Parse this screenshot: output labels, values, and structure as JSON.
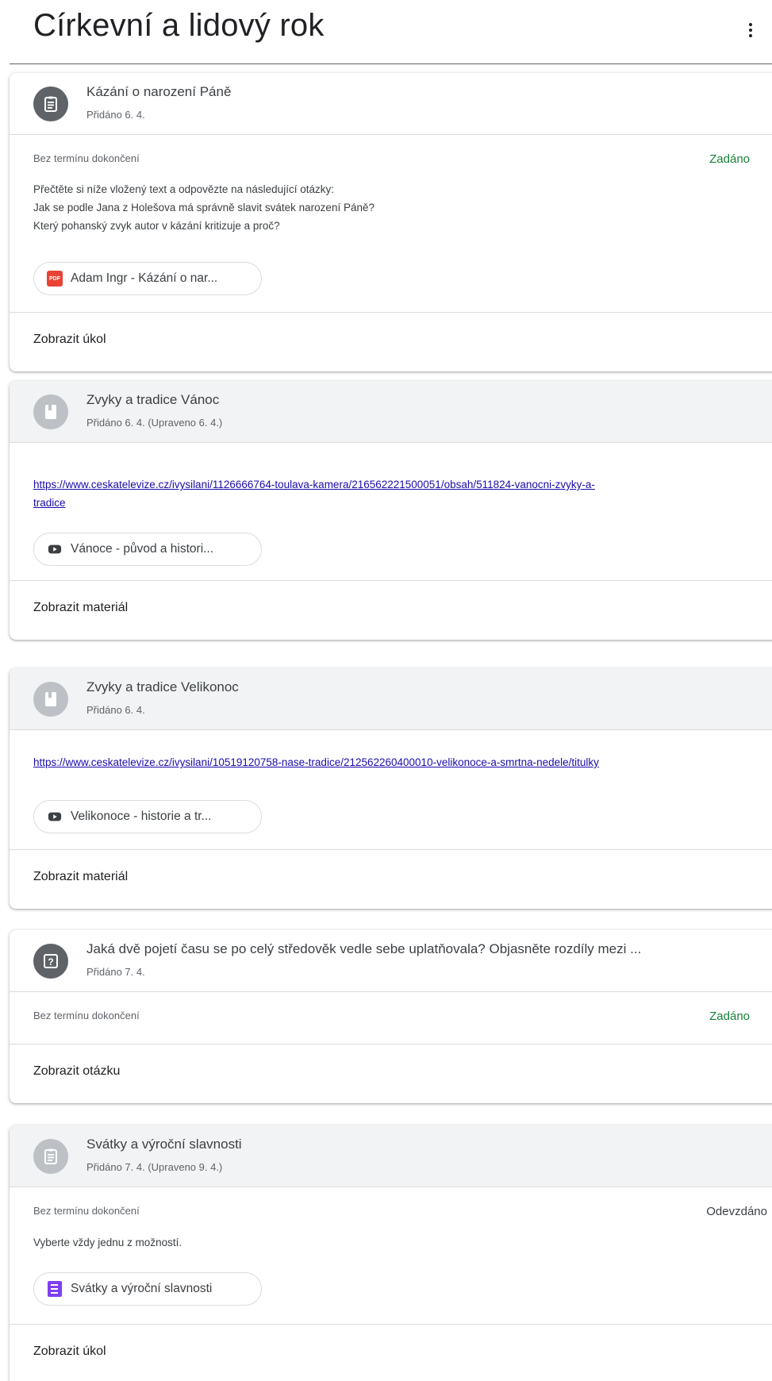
{
  "page": {
    "title": "Církevní a lidový rok"
  },
  "icons": {
    "menu": "more-vert-icon",
    "assignment": "assignment-icon",
    "material": "book-icon",
    "question": "question-icon",
    "pdf": "pdf-icon",
    "youtube": "youtube-icon",
    "forms": "forms-icon"
  },
  "colors": {
    "status_assigned": "#188038",
    "link": "#1a0dab",
    "pdf": "#ea4335",
    "forms": "#7e3ff2"
  },
  "cards": [
    {
      "type": "assignment",
      "title": "Kázání o narození Páně",
      "posted": "Přidáno 6. 4.",
      "due": "Bez termínu dokončení",
      "status": "Zadáno",
      "description": [
        "Přečtěte si níže vložený text a odpovězte na následující otázky:",
        "Jak se podle Jana z Holešova má správně slavit svátek narození Páně?",
        "Který pohanský zvyk autor v kázání kritizuje a proč?"
      ],
      "attachment": "Adam Ingr - Kázání o nar...",
      "footer": "Zobrazit úkol"
    },
    {
      "type": "material",
      "title": "Zvyky a tradice Vánoc",
      "posted": "Přidáno 6. 4. (Upraveno 6. 4.)",
      "link_line1": "https://www.ceskatelevize.cz/ivysilani/1126666764-toulava-kamera/216562221500051/obsah/511824-vanocni-zvyky-a-",
      "link_line2": "tradice",
      "attachment": "Vánoce - původ a histori...",
      "footer": "Zobrazit materiál"
    },
    {
      "type": "material",
      "title": "Zvyky a tradice Velikonoc",
      "posted": "Přidáno 6. 4.",
      "link_line1": "https://www.ceskatelevize.cz/ivysilani/10519120758-nase-tradice/212562260400010-velikonoce-a-smrtna-nedele/titulky",
      "attachment": "Velikonoce - historie a tr...",
      "footer": "Zobrazit materiál"
    },
    {
      "type": "question",
      "title": "Jaká dvě pojetí času se po celý středověk vedle sebe uplatňovala? Objasněte rozdíly mezi ...",
      "posted": "Přidáno 7. 4.",
      "due": "Bez termínu dokončení",
      "status": "Zadáno",
      "footer": "Zobrazit otázku"
    },
    {
      "type": "assignment",
      "title": "Svátky a výroční slavnosti",
      "posted": "Přidáno 7. 4. (Upraveno 9. 4.)",
      "due": "Bez termínu dokončení",
      "status": "Odevzdáno",
      "description": [
        "Vyberte vždy jednu z možností."
      ],
      "attachment": "Svátky a výroční slavnosti",
      "footer": "Zobrazit úkol"
    }
  ]
}
